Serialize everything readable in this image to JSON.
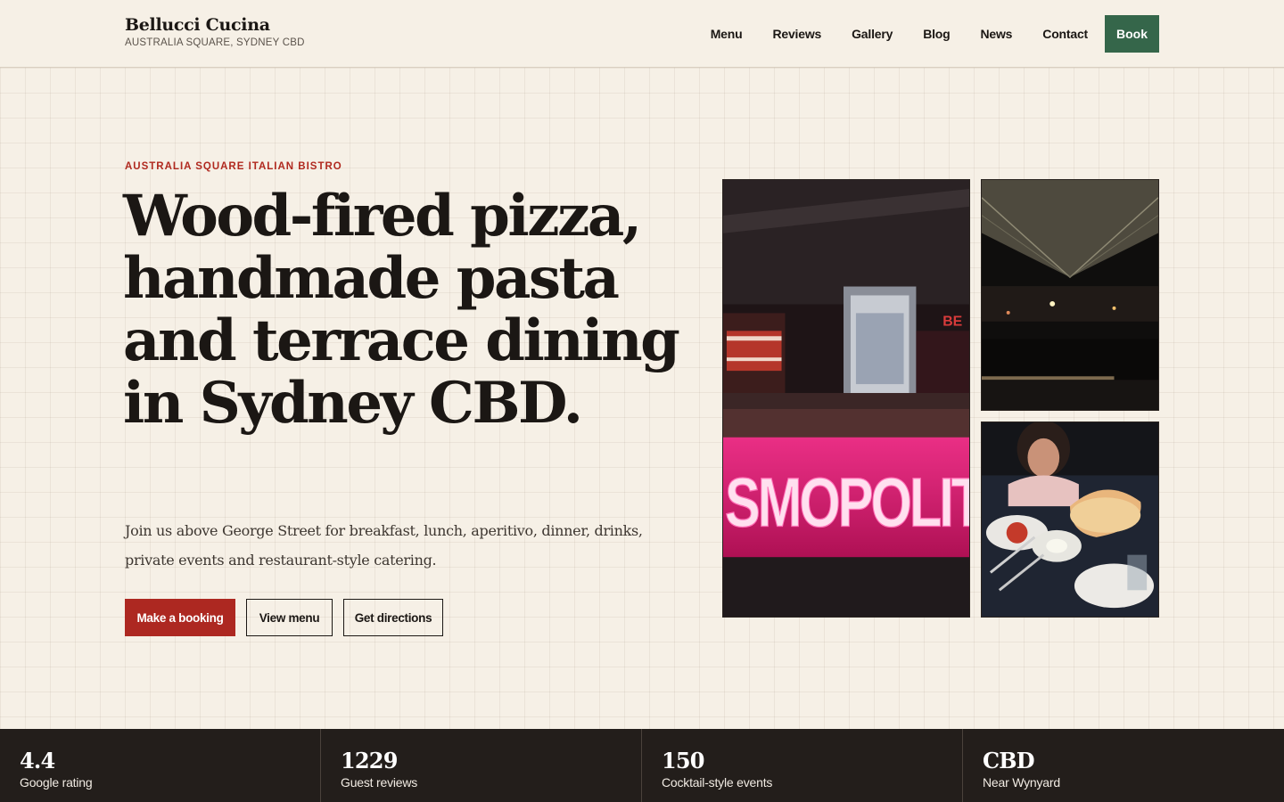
{
  "header": {
    "brand_name": "Bellucci Cucina",
    "brand_sub": "AUSTRALIA SQUARE, SYDNEY CBD",
    "nav": [
      "Menu",
      "Reviews",
      "Gallery",
      "Blog",
      "News",
      "Contact"
    ],
    "book_label": "Book"
  },
  "hero": {
    "eyebrow": "AUSTRALIA SQUARE ITALIAN BISTRO",
    "title": "Wood-fired pizza, handmade pasta and terrace dining in Sydney CBD.",
    "lead": "Join us above George Street for breakfast, lunch, aperitivo, dinner, drinks, private events and restaurant-style catering.",
    "buttons": {
      "booking": "Make a booking",
      "menu": "View menu",
      "directions": "Get directions"
    }
  },
  "photos": {
    "neon_text": "SMOPOLIT",
    "sign_fragment": "BE"
  },
  "stats": [
    {
      "value": "4.4",
      "label": "Google rating"
    },
    {
      "value": "1229",
      "label": "Guest reviews"
    },
    {
      "value": "150",
      "label": "Cocktail-style events"
    },
    {
      "value": "CBD",
      "label": "Near Wynyard"
    }
  ],
  "colors": {
    "background": "#f6f0e6",
    "accent_red": "#ad2821",
    "accent_green": "#35664a",
    "footer_dark": "#231e1b"
  }
}
